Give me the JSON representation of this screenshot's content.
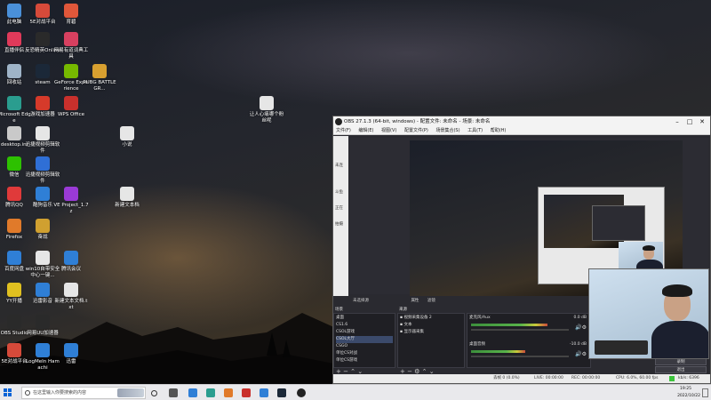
{
  "desktop_icons": [
    {
      "label": "此电脑",
      "color": "#4a90d9"
    },
    {
      "label": "5E对战平台",
      "color": "#d64a3a"
    },
    {
      "label": "育碧",
      "color": "#e0573a"
    },
    {
      "label": "直播伴侣",
      "color": "#e03a5a"
    },
    {
      "label": "反恐精英Online",
      "color": "#2a2a2a"
    },
    {
      "label": "网易有道词典工具",
      "color": "#d84060"
    },
    {
      "label": "回收站",
      "color": "#9fb4c8"
    },
    {
      "label": "steam",
      "color": "#1b2838"
    },
    {
      "label": "GeForce Experience",
      "color": "#76b900"
    },
    {
      "label": "PUBG BATTLEGR...",
      "color": "#d8a030"
    },
    {
      "label": "Microsoft Edge",
      "color": "#2a9d8f"
    },
    {
      "label": "游戏加速器",
      "color": "#d63a2a"
    },
    {
      "label": "WPS Office",
      "color": "#c9302c"
    },
    {
      "label": "desktop.ini",
      "color": "#c9c9c9"
    },
    {
      "label": "迅捷视频剪辑软件",
      "color": "#e6e6e6"
    },
    {
      "label": "小说",
      "color": "#e6e6e6"
    },
    {
      "label": "微信",
      "color": "#2dc100"
    },
    {
      "label": "迅捷视频剪辑软件",
      "color": "#2f6fd6"
    },
    {
      "label": "腾讯QQ",
      "color": "#e03a3a"
    },
    {
      "label": "酷狗音乐",
      "color": "#2f7fd6"
    },
    {
      "label": "VE Project_1.7z",
      "color": "#9a3ad6"
    },
    {
      "label": "新建文本档",
      "color": "#e6e6e6"
    },
    {
      "label": "Firefox",
      "color": "#e07a2a"
    },
    {
      "label": "奋战",
      "color": "#d0a030"
    },
    {
      "label": "百度网盘",
      "color": "#2f7fd6"
    },
    {
      "label": "win10自带安全中心一键...",
      "color": "#e6e6e6"
    },
    {
      "label": "腾讯会议",
      "color": "#2f7fd6"
    },
    {
      "label": "YY开播",
      "color": "#e0c020"
    },
    {
      "label": "迅雷影音",
      "color": "#2f7fd6"
    },
    {
      "label": "新建文本文档.txt",
      "color": "#e6e6e6"
    },
    {
      "label": "OBS Studio",
      "color": "#2a2a2a"
    },
    {
      "label": "网易UU加速器",
      "color": "#2a2a2a"
    },
    {
      "label": "5E对战平台",
      "color": "#d64a3a"
    },
    {
      "label": "LogMeIn Hamachi",
      "color": "#2f7fd6"
    },
    {
      "label": "迅雷",
      "color": "#2f7fd6"
    },
    {
      "label": "让人心痛哪个粉丝呢",
      "color": "#e6e6e6"
    }
  ],
  "obs": {
    "title": "OBS 27.1.3 (64-bit, windows) - 配置文件: 未命名 - 场景: 未命名",
    "menu": [
      "文件(F)",
      "编辑(E)",
      "视图(V)",
      "配置文件(P)",
      "场景集合(S)",
      "工具(T)",
      "帮助(H)"
    ],
    "left_tabs": [
      "未连",
      "斗鱼",
      "正在",
      "拍摄"
    ],
    "scene_label": "未选择源",
    "props_label": "属性",
    "filters_label": "滤镜",
    "scenes_header": "场景",
    "scenes": [
      "桌面",
      "CS1.6",
      "CSOL游戏",
      "CSOL大厅",
      "CSGO",
      "单位CS对战",
      "单位CS游戏"
    ],
    "selected_scene": "CSOL大厅",
    "sources_header": "来源",
    "sources": [
      {
        "name": "视频采集设备 2",
        "icon": "camera-icon"
      },
      {
        "name": "文本",
        "icon": "text-icon"
      },
      {
        "name": "显示器采集",
        "icon": "monitor-icon"
      }
    ],
    "mixer": [
      {
        "name": "麦克风/Aux",
        "db": "0.0 dB",
        "level": 0.78
      },
      {
        "name": "桌面音频",
        "db": "-10.0 dB",
        "level": 0.55
      }
    ],
    "controls": [
      {
        "label": "录制"
      },
      {
        "label": "退出"
      }
    ],
    "status": {
      "dropped": "丢帧 0 (0.0%)",
      "live": "LIVE: 00:00:00",
      "rec": "REC: 00:00:00",
      "cpu": "CPU: 6.0%, 60.00 fps",
      "kbps": "kb/s: 6396"
    }
  },
  "taskbar": {
    "search_placeholder": "在这里输入你要搜索的内容",
    "time": "19:25",
    "date": "2022/10/22"
  }
}
